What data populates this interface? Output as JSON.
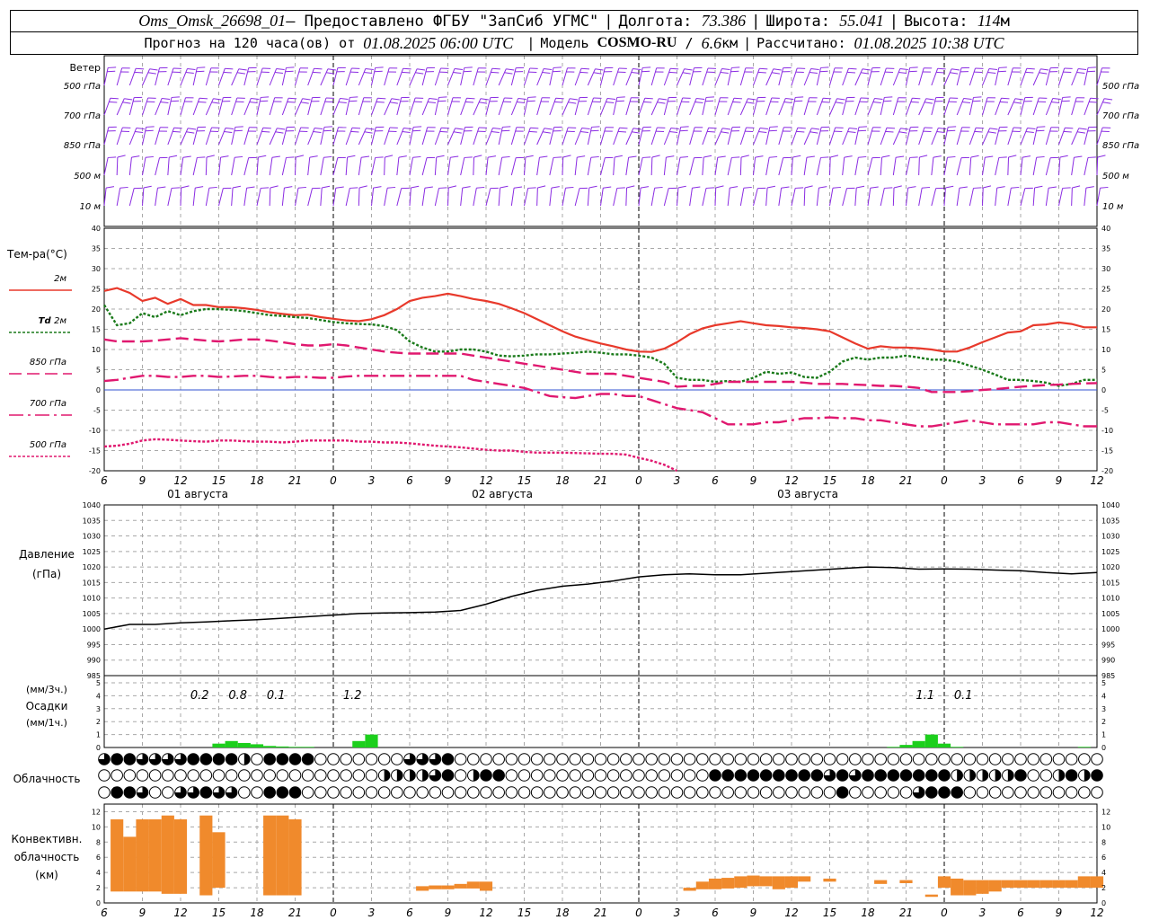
{
  "header": {
    "station": "Oms_Omsk_26698_01",
    "provided": " – Предоставлено ФГБУ \"ЗапСиб УГМС\"",
    "lon_label": "Долгота:",
    "lon_value": "73.386",
    "lat_label": "Широта:",
    "lat_value": "55.041",
    "alt_label": "Высота:",
    "alt_value": "114",
    "alt_unit": "м",
    "forecast_label": "Прогноз на 120 часа(ов) от",
    "forecast_start": "01.08.2025 06:00 UTC",
    "model_label": "Модель",
    "model_name": "COSMO-RU",
    "model_res": "6.6",
    "model_res_unit": "км",
    "computed_label": "Рассчитано:",
    "computed_value": "01.08.2025 10:38 UTC"
  },
  "colors": {
    "wind": "#8a2be2",
    "t2m": "#e8392b",
    "td2m": "#1a7a1a",
    "t850": "#e0186f",
    "t700": "#e0186f",
    "t500": "#e0186f",
    "zero_line": "#3050d0",
    "pressure": "#000000",
    "precip": "#1ccf1c",
    "convective": "#f08a2c",
    "grid": "#a8a8a8"
  },
  "wind_panel": {
    "title": "Ветер",
    "levels": [
      "500 гПа",
      "700 гПа",
      "850 гПа",
      "500 м",
      "10 м"
    ]
  },
  "temp_panel": {
    "title": "Тем-ра(°С)",
    "legend": [
      {
        "key": "t2m",
        "label": "2м"
      },
      {
        "key": "td2m",
        "prefix": "Td",
        "label": "2м"
      },
      {
        "key": "t850",
        "label": "850 гПа"
      },
      {
        "key": "t700",
        "label": "700 гПа"
      },
      {
        "key": "t500",
        "label": "500 гПа"
      }
    ]
  },
  "pressure_panel": {
    "title_line1": "Давление",
    "title_line2": "(гПа)"
  },
  "precip_panel": {
    "title_line1": "(мм/3ч.)",
    "title_line2": "Осадки",
    "title_line3": "(мм/1ч.)"
  },
  "cloud_panel": {
    "title": "Облачность"
  },
  "conv_panel": {
    "title_line1": "Конвективн.",
    "title_line2": "облачность",
    "title_line3": "(км)"
  },
  "x_axis": {
    "hour_ticks": [
      "6",
      "9",
      "12",
      "15",
      "18",
      "21",
      "0",
      "3",
      "6",
      "9",
      "12",
      "15",
      "18",
      "21",
      "0",
      "3",
      "6",
      "9",
      "12",
      "15",
      "18",
      "21",
      "0",
      "3",
      "6",
      "9",
      "12"
    ],
    "dates": [
      "01 августа",
      "02 августа",
      "03 августа"
    ]
  },
  "chart_data": [
    {
      "type": "line",
      "title": "Тем-ра(°С)",
      "x_hours": [
        0,
        1,
        2,
        3,
        4,
        5,
        6,
        7,
        8,
        9,
        10,
        11,
        12,
        13,
        14,
        15,
        16,
        17,
        18,
        19,
        20,
        21,
        22,
        23,
        24,
        25,
        26,
        27,
        28,
        29,
        30,
        31,
        32,
        33,
        34,
        35,
        36,
        37,
        38,
        39,
        40,
        41,
        42,
        43,
        44,
        45,
        46,
        47,
        48,
        49,
        50,
        51,
        52,
        53,
        54,
        55,
        56,
        57,
        58,
        59,
        60,
        61,
        62,
        63,
        64,
        65,
        66,
        67,
        68,
        69,
        70,
        71,
        72,
        73,
        74,
        75,
        76,
        77,
        78
      ],
      "ylim": [
        -20,
        40
      ],
      "yticks": [
        -20,
        -15,
        -10,
        -5,
        0,
        5,
        10,
        15,
        20,
        25,
        30,
        35,
        40
      ],
      "series": [
        {
          "name": "2м",
          "color": "#e8392b",
          "dash": "",
          "values": [
            24.5,
            25.2,
            24.0,
            22.0,
            22.8,
            21.3,
            22.5,
            21.0,
            21.0,
            20.5,
            20.5,
            20.2,
            19.8,
            19.2,
            18.8,
            18.5,
            18.6,
            18.0,
            17.6,
            17.2,
            17.0,
            17.5,
            18.5,
            20.0,
            22.0,
            22.8,
            23.2,
            23.8,
            23.2,
            22.5,
            22.0,
            21.3,
            20.2,
            19.0,
            17.5,
            16.0,
            14.5,
            13.2,
            12.3,
            11.5,
            10.8,
            10.0,
            9.5,
            9.4,
            10.2,
            11.8,
            13.8,
            15.2,
            16.0,
            16.5,
            17.0,
            16.5,
            16.0,
            15.8,
            15.5,
            15.3,
            15.0,
            14.5,
            13.0,
            11.5,
            10.2,
            10.8,
            10.5,
            10.5,
            10.3,
            10.0,
            9.5,
            9.5,
            10.5,
            11.8,
            13.0,
            14.2,
            14.5,
            16.0,
            16.2,
            16.7,
            16.3,
            15.5,
            15.5
          ]
        },
        {
          "name": "Td 2м",
          "color": "#1a7a1a",
          "dash": "3,2",
          "values": [
            21.0,
            16.0,
            16.5,
            19.0,
            18.0,
            19.5,
            18.5,
            19.5,
            20.0,
            20.0,
            19.8,
            19.5,
            19.0,
            18.5,
            18.3,
            18.0,
            17.8,
            17.3,
            16.8,
            16.5,
            16.3,
            16.2,
            15.8,
            14.8,
            12.0,
            10.5,
            9.5,
            9.5,
            10.0,
            10.0,
            9.5,
            8.5,
            8.3,
            8.5,
            8.8,
            8.8,
            9.0,
            9.2,
            9.5,
            9.2,
            8.8,
            8.8,
            8.5,
            8.0,
            6.5,
            3.0,
            2.5,
            2.5,
            2.0,
            2.2,
            2.0,
            3.0,
            4.5,
            4.0,
            4.3,
            3.2,
            3.0,
            4.5,
            7.0,
            8.0,
            7.5,
            8.0,
            8.0,
            8.5,
            8.0,
            7.5,
            7.5,
            7.0,
            6.0,
            5.0,
            3.8,
            2.5,
            2.5,
            2.2,
            1.8,
            1.0,
            1.5,
            2.5,
            2.5
          ]
        },
        {
          "name": "850 гПа",
          "color": "#e0186f",
          "dash": "14,6",
          "values": [
            12.5,
            12.0,
            12.0,
            12.0,
            12.2,
            12.5,
            12.8,
            12.5,
            12.2,
            12.0,
            12.2,
            12.5,
            12.5,
            12.2,
            11.8,
            11.3,
            11.0,
            11.0,
            11.3,
            11.0,
            10.5,
            10.0,
            9.5,
            9.2,
            9.0,
            9.0,
            9.0,
            9.0,
            9.0,
            8.5,
            8.0,
            7.5,
            7.0,
            6.5,
            6.0,
            5.5,
            5.0,
            4.5,
            4.0,
            4.0,
            4.0,
            3.5,
            3.0,
            2.5,
            2.0,
            0.8,
            1.0,
            1.0,
            1.5,
            2.0,
            2.0,
            2.0,
            2.0,
            2.0,
            2.0,
            1.8,
            1.5,
            1.5,
            1.5,
            1.3,
            1.2,
            1.0,
            1.0,
            0.8,
            0.5,
            -0.5,
            -0.5,
            -0.5,
            -0.3,
            0.0,
            0.2,
            0.5,
            0.8,
            1.0,
            1.2,
            1.3,
            1.5,
            1.6,
            1.7
          ]
        },
        {
          "name": "700 гПа",
          "color": "#e0186f",
          "dash": "16,5,3,5",
          "values": [
            2.2,
            2.5,
            3.0,
            3.5,
            3.5,
            3.2,
            3.2,
            3.5,
            3.5,
            3.2,
            3.3,
            3.5,
            3.5,
            3.2,
            3.0,
            3.2,
            3.2,
            3.0,
            3.0,
            3.3,
            3.5,
            3.5,
            3.5,
            3.5,
            3.5,
            3.5,
            3.5,
            3.5,
            3.5,
            2.5,
            2.0,
            1.5,
            1.0,
            0.5,
            -0.5,
            -1.5,
            -1.8,
            -2.0,
            -1.5,
            -1.0,
            -1.0,
            -1.5,
            -1.5,
            -2.5,
            -3.5,
            -4.5,
            -5.0,
            -5.5,
            -7.0,
            -8.5,
            -8.5,
            -8.5,
            -8.0,
            -8.0,
            -7.5,
            -7.0,
            -7.0,
            -6.8,
            -7.0,
            -7.0,
            -7.5,
            -7.5,
            -8.0,
            -8.5,
            -9.0,
            -9.0,
            -8.5,
            -8.0,
            -7.5,
            -8.0,
            -8.5,
            -8.5,
            -8.5,
            -8.5,
            -8.0,
            -8.0,
            -8.5,
            -9.0,
            -9.0
          ]
        },
        {
          "name": "500 гПа",
          "color": "#e0186f",
          "dash": "3,2",
          "values": [
            -14.0,
            -13.8,
            -13.3,
            -12.5,
            -12.2,
            -12.3,
            -12.5,
            -12.7,
            -12.8,
            -12.5,
            -12.5,
            -12.7,
            -12.8,
            -12.8,
            -13.0,
            -12.8,
            -12.5,
            -12.5,
            -12.5,
            -12.5,
            -12.8,
            -12.8,
            -13.0,
            -13.0,
            -13.2,
            -13.5,
            -13.8,
            -14.0,
            -14.2,
            -14.5,
            -14.8,
            -15.0,
            -15.0,
            -15.3,
            -15.5,
            -15.5,
            -15.5,
            -15.6,
            -15.7,
            -15.8,
            -15.8,
            -16.0,
            -16.8,
            -17.5,
            -18.5,
            -20.0
          ]
        }
      ]
    },
    {
      "type": "line",
      "title": "Давление (гПа)",
      "x_hours": [
        0,
        2,
        4,
        6,
        8,
        10,
        12,
        14,
        16,
        18,
        20,
        22,
        24,
        26,
        28,
        30,
        32,
        34,
        36,
        38,
        40,
        42,
        44,
        46,
        48,
        50,
        52,
        54,
        56,
        58,
        60,
        62,
        64,
        66,
        68,
        70,
        72,
        74,
        76,
        78
      ],
      "ylim": [
        985,
        1040
      ],
      "yticks": [
        985,
        990,
        995,
        1000,
        1005,
        1010,
        1015,
        1020,
        1025,
        1030,
        1035,
        1040
      ],
      "series": [
        {
          "name": "Давление",
          "values": [
            1000,
            1001.5,
            1001.5,
            1002,
            1002.3,
            1002.7,
            1003,
            1003.5,
            1004,
            1004.5,
            1005,
            1005.2,
            1005.3,
            1005.5,
            1006,
            1008,
            1010.5,
            1012.5,
            1013.8,
            1014.5,
            1015.5,
            1016.8,
            1017.5,
            1017.8,
            1017.5,
            1017.5,
            1018,
            1018.5,
            1019,
            1019.5,
            1020,
            1019.8,
            1019.3,
            1019.4,
            1019.3,
            1019,
            1018.8,
            1018.2,
            1017.8,
            1018.2
          ]
        }
      ]
    },
    {
      "type": "bar",
      "title": "Осадки (мм/1ч.)",
      "x_hours": [
        9,
        10,
        11,
        12,
        13,
        14,
        15,
        16,
        19,
        20,
        21,
        22,
        62,
        63,
        64,
        65,
        66,
        67,
        77
      ],
      "values": [
        0.3,
        0.5,
        0.35,
        0.25,
        0.12,
        0.08,
        0.05,
        0.05,
        0.0,
        0.5,
        1.0,
        0.0,
        0.05,
        0.2,
        0.5,
        1.0,
        0.3,
        0.05,
        0.05
      ],
      "ylim": [
        0,
        5
      ],
      "annotations": [
        {
          "x_hour": 7.5,
          "text": "0.2"
        },
        {
          "x_hour": 10.5,
          "text": "0.8"
        },
        {
          "x_hour": 13.5,
          "text": "0.1"
        },
        {
          "x_hour": 19.5,
          "text": "1.2"
        },
        {
          "x_hour": 64.5,
          "text": "1.1"
        },
        {
          "x_hour": 67.5,
          "text": "0.1"
        }
      ]
    },
    {
      "type": "bar",
      "title": "Конвективн. облачность (км)",
      "ylim": [
        0,
        13
      ],
      "yticks": [
        0,
        2,
        4,
        6,
        8,
        10,
        12
      ],
      "ranges": [
        {
          "x_hour": 1,
          "bottom": 1.5,
          "top": 11.0
        },
        {
          "x_hour": 2,
          "bottom": 1.5,
          "top": 8.7
        },
        {
          "x_hour": 3,
          "bottom": 1.5,
          "top": 11.0
        },
        {
          "x_hour": 4,
          "bottom": 1.5,
          "top": 11.0
        },
        {
          "x_hour": 5,
          "bottom": 1.2,
          "top": 11.5
        },
        {
          "x_hour": 6,
          "bottom": 1.2,
          "top": 11.0
        },
        {
          "x_hour": 8,
          "bottom": 1.0,
          "top": 11.5
        },
        {
          "x_hour": 9,
          "bottom": 2.0,
          "top": 9.3
        },
        {
          "x_hour": 13,
          "bottom": 1.0,
          "top": 11.5
        },
        {
          "x_hour": 14,
          "bottom": 1.0,
          "top": 11.5
        },
        {
          "x_hour": 15,
          "bottom": 1.0,
          "top": 11.0
        },
        {
          "x_hour": 25,
          "bottom": 1.6,
          "top": 2.2
        },
        {
          "x_hour": 26,
          "bottom": 1.8,
          "top": 2.3
        },
        {
          "x_hour": 27,
          "bottom": 1.8,
          "top": 2.3
        },
        {
          "x_hour": 28,
          "bottom": 1.9,
          "top": 2.5
        },
        {
          "x_hour": 29,
          "bottom": 1.9,
          "top": 2.8
        },
        {
          "x_hour": 30,
          "bottom": 1.6,
          "top": 2.8
        },
        {
          "x_hour": 46,
          "bottom": 1.6,
          "top": 2.0
        },
        {
          "x_hour": 47,
          "bottom": 1.8,
          "top": 2.8
        },
        {
          "x_hour": 48,
          "bottom": 1.8,
          "top": 3.2
        },
        {
          "x_hour": 49,
          "bottom": 1.9,
          "top": 3.3
        },
        {
          "x_hour": 50,
          "bottom": 2.0,
          "top": 3.5
        },
        {
          "x_hour": 51,
          "bottom": 2.2,
          "top": 3.6
        },
        {
          "x_hour": 52,
          "bottom": 2.2,
          "top": 3.5
        },
        {
          "x_hour": 53,
          "bottom": 1.8,
          "top": 3.5
        },
        {
          "x_hour": 54,
          "bottom": 2.0,
          "top": 3.5
        },
        {
          "x_hour": 55,
          "bottom": 2.8,
          "top": 3.5
        },
        {
          "x_hour": 57,
          "bottom": 2.8,
          "top": 3.2
        },
        {
          "x_hour": 61,
          "bottom": 2.5,
          "top": 3.0
        },
        {
          "x_hour": 63,
          "bottom": 2.6,
          "top": 3.0
        },
        {
          "x_hour": 65,
          "bottom": 0.8,
          "top": 1.1
        },
        {
          "x_hour": 66,
          "bottom": 2.0,
          "top": 3.5
        },
        {
          "x_hour": 67,
          "bottom": 1.0,
          "top": 3.2
        },
        {
          "x_hour": 68,
          "bottom": 1.0,
          "top": 3.0
        },
        {
          "x_hour": 69,
          "bottom": 1.2,
          "top": 3.0
        },
        {
          "x_hour": 70,
          "bottom": 1.5,
          "top": 3.0
        },
        {
          "x_hour": 71,
          "bottom": 2.0,
          "top": 3.0
        },
        {
          "x_hour": 72,
          "bottom": 2.0,
          "top": 3.0
        },
        {
          "x_hour": 73,
          "bottom": 2.0,
          "top": 3.0
        },
        {
          "x_hour": 74,
          "bottom": 2.0,
          "top": 3.0
        },
        {
          "x_hour": 75,
          "bottom": 2.0,
          "top": 3.0
        },
        {
          "x_hour": 76,
          "bottom": 2.0,
          "top": 3.0
        },
        {
          "x_hour": 77,
          "bottom": 2.0,
          "top": 3.5
        },
        {
          "x_hour": 78,
          "bottom": 2.0,
          "top": 3.5
        }
      ]
    },
    {
      "type": "table",
      "title": "Облачность",
      "rows": [
        "3,4,4,3,3,3,3,4,4,4,4,2,0,4,4,4,4,0,0,0,0,0,0,0,3,3,3,4,0,0,0,0,0,0,0,0,0,0,0,0,0,0,0,0,0,0,0,0,0,0,0,0,0,0,0,0,0,0,0,0,0,0,0,0,0,0,0,0,0,0,0,0,0,0,0,0,0,0,0",
        "0,0,0,0,0,0,0,0,0,0,0,0,0,0,0,0,0,0,0,0,0,0,2,2,2,2,3,4,0,2,4,4,0,0,0,0,0,0,0,0,0,0,0,0,0,0,0,0,4,4,4,4,4,4,4,4,4,3,4,3,4,4,4,4,4,4,4,2,2,2,2,2,4,0,0,2,4,2,4",
        "0,4,4,3,0,0,3,3,4,3,3,0,0,4,4,4,0,0,0,0,0,0,0,0,0,0,0,0,0,0,0,0,0,0,0,0,0,0,0,0,0,0,0,0,0,0,0,0,0,0,0,0,0,0,0,0,0,0,4,0,0,0,0,0,3,4,4,4,0,0,0,0,0,0,0,0,0,0,0"
      ]
    }
  ]
}
